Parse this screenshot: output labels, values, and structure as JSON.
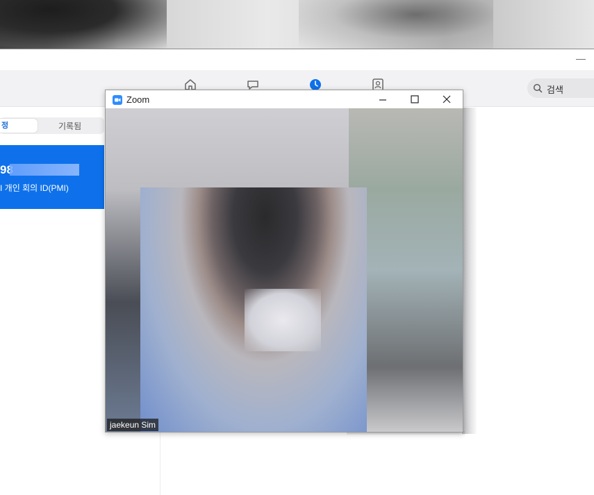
{
  "zoom_window": {
    "title": "Zoom",
    "participant_name": "jaekeun Sim"
  },
  "nav": {
    "search_placeholder": "검색"
  },
  "left_panel": {
    "tabs": {
      "active_label": "정",
      "record_label": "기록됨"
    },
    "pmi": {
      "number_partial": "98",
      "label": "I 개인 회의 ID(PMI)"
    }
  },
  "app_titlebar": {
    "minimize_label": "—"
  },
  "colors": {
    "accent": "#0e71eb",
    "zoom_logo": "#2d8cff"
  }
}
